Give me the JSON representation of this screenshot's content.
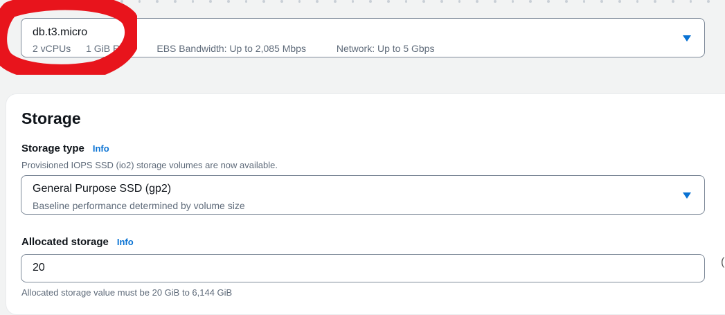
{
  "instance_class": {
    "value": "db.t3.micro",
    "specs": {
      "vcpus": "2 vCPUs",
      "ram": "1 GiB RA",
      "ebs": "EBS Bandwidth: Up to 2,085 Mbps",
      "network": "Network: Up to 5 Gbps"
    }
  },
  "storage": {
    "title": "Storage",
    "storage_type": {
      "label": "Storage type",
      "info": "Info",
      "description": "Provisioned IOPS SSD (io2) storage volumes are now available.",
      "selected": "General Purpose SSD (gp2)",
      "selected_sub": "Baseline performance determined by volume size"
    },
    "allocated_storage": {
      "label": "Allocated storage",
      "info": "Info",
      "value": "20",
      "hint": "Allocated storage value must be 20 GiB to 6,144 GiB"
    }
  },
  "annotation_color": "#e8141c",
  "accent_color": "#0972d3",
  "edge_glyph": "("
}
